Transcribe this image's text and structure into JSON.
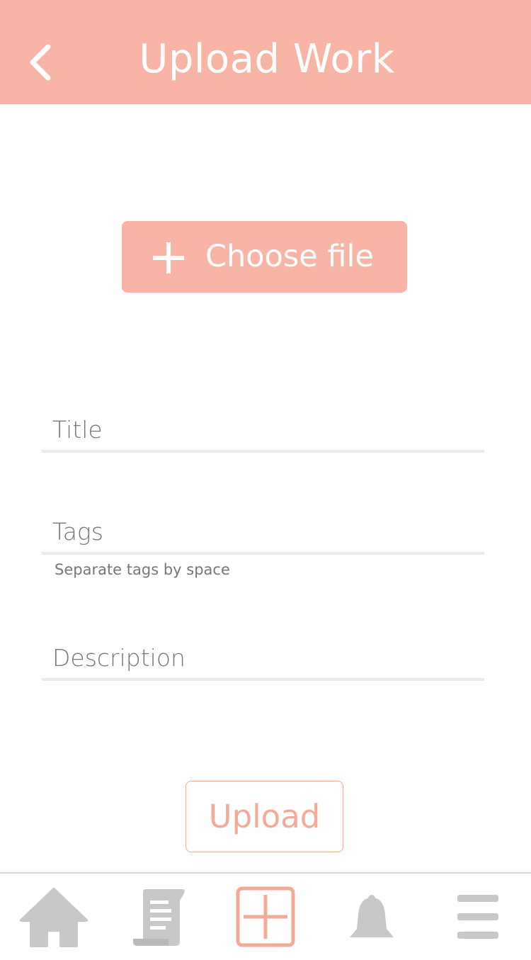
{
  "header": {
    "title": "Upload Work",
    "back_icon": "chevron-left-icon"
  },
  "choose_file": {
    "icon": "plus-icon",
    "label": "Choose file"
  },
  "form": {
    "title_placeholder": "Title",
    "title_value": "",
    "tags_placeholder": "Tags",
    "tags_value": "",
    "tags_hint": "Separate tags by space",
    "description_placeholder": "Description",
    "description_value": ""
  },
  "upload": {
    "label": "Upload"
  },
  "bottom_nav": {
    "items": [
      {
        "icon": "home-icon",
        "active": false
      },
      {
        "icon": "scroll-icon",
        "active": false
      },
      {
        "icon": "add-icon",
        "active": true
      },
      {
        "icon": "bell-icon",
        "active": false
      },
      {
        "icon": "menu-icon",
        "active": false
      }
    ]
  },
  "colors": {
    "accent": "#f8b4a5",
    "accent_outline": "#f4aa98",
    "inactive_icon": "#c8c8c8",
    "divider": "#ebebeb"
  }
}
